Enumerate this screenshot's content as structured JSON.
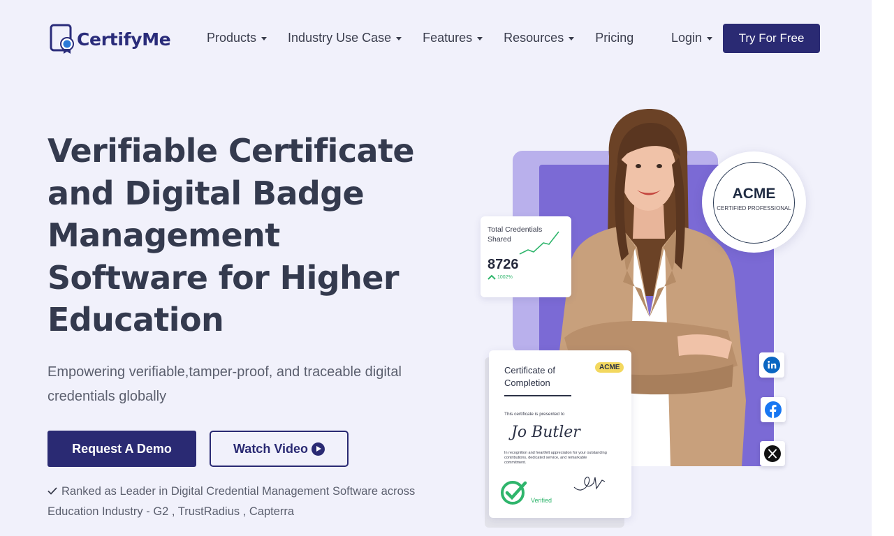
{
  "brand": {
    "name": "CertifyMe",
    "color": "#2a2a73"
  },
  "nav": {
    "items": [
      {
        "label": "Products",
        "has_dropdown": true
      },
      {
        "label": "Industry Use Case",
        "has_dropdown": true
      },
      {
        "label": "Features",
        "has_dropdown": true
      },
      {
        "label": "Resources",
        "has_dropdown": true
      },
      {
        "label": "Pricing",
        "has_dropdown": false
      }
    ],
    "login_label": "Login",
    "cta_label": "Try For Free"
  },
  "hero": {
    "title": "Verifiable Certificate and Digital Badge Management Software for Higher Education",
    "subtitle": "Empowering verifiable,tamper-proof, and traceable digital credentials globally",
    "demo_label": "Request A Demo",
    "video_label": "Watch Video",
    "ranked_text": "Ranked as Leader in Digital Credential Management Software across Education Industry - G2 , TrustRadius , Capterra"
  },
  "stats_card": {
    "label": "Total Credentials Shared",
    "value": "8726",
    "growth": "1002%"
  },
  "badge": {
    "title": "ACME",
    "subtitle": "CERTIFIED PROFESSIONAL"
  },
  "certificate": {
    "title": "Certificate of Completion",
    "tag": "ACME",
    "presented": "This certificate is presented to",
    "recipient": "Jo Butler",
    "body": "In recognition and heartfelt appreciation for your outstanding contributions, dedicated service, and remarkable commitment.",
    "verified_label": "Verified"
  },
  "social": {
    "icons": [
      "linkedin-icon",
      "facebook-icon",
      "x-icon"
    ]
  }
}
